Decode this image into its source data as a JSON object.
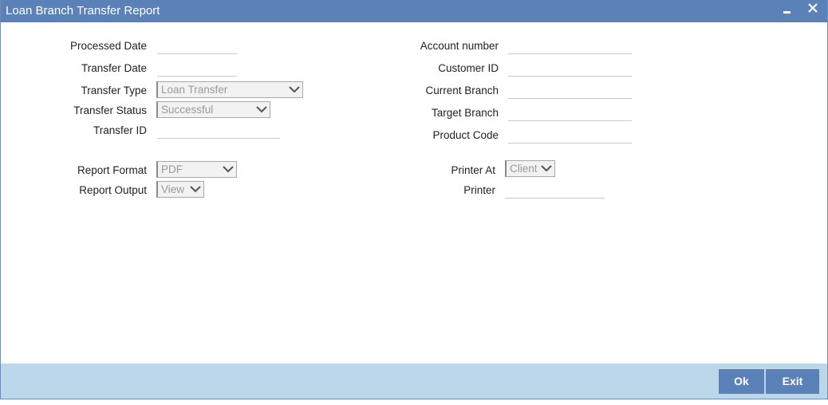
{
  "window": {
    "title": "Loan Branch Transfer Report"
  },
  "left": {
    "processed_date": {
      "label": "Processed Date",
      "value": ""
    },
    "transfer_date": {
      "label": "Transfer Date",
      "value": ""
    },
    "transfer_type": {
      "label": "Transfer Type",
      "value": "Loan Transfer"
    },
    "transfer_status": {
      "label": "Transfer Status",
      "value": "Successful"
    },
    "transfer_id": {
      "label": "Transfer ID",
      "value": ""
    },
    "report_format": {
      "label": "Report Format",
      "value": "PDF"
    },
    "report_output": {
      "label": "Report Output",
      "value": "View"
    }
  },
  "right": {
    "account_number": {
      "label": "Account number",
      "value": ""
    },
    "customer_id": {
      "label": "Customer ID",
      "value": ""
    },
    "current_branch": {
      "label": "Current Branch",
      "value": ""
    },
    "target_branch": {
      "label": "Target Branch",
      "value": ""
    },
    "product_code": {
      "label": "Product Code",
      "value": ""
    },
    "printer_at": {
      "label": "Printer At",
      "value": "Client"
    },
    "printer": {
      "label": "Printer",
      "value": ""
    }
  },
  "footer": {
    "ok_label": "Ok",
    "exit_label": "Exit"
  },
  "colors": {
    "titlebar": "#5a82b8",
    "footer": "#bcd6ea",
    "button": "#5a82b8"
  },
  "icons": {
    "minimize": "minimize-icon",
    "close": "close-icon",
    "dropdown": "chevron-down-icon"
  }
}
